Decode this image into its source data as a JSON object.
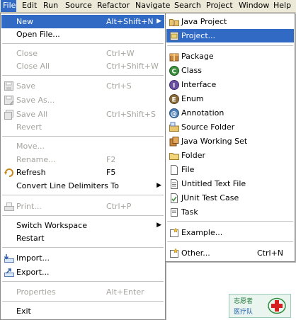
{
  "menubar": [
    {
      "id": "file",
      "label": "File"
    },
    {
      "id": "edit",
      "label": "Edit"
    },
    {
      "id": "run",
      "label": "Run"
    },
    {
      "id": "source",
      "label": "Source"
    },
    {
      "id": "refactor",
      "label": "Refactor"
    },
    {
      "id": "navigate",
      "label": "Navigate"
    },
    {
      "id": "search",
      "label": "Search"
    },
    {
      "id": "project",
      "label": "Project"
    },
    {
      "id": "window",
      "label": "Window"
    },
    {
      "id": "help",
      "label": "Help"
    }
  ],
  "file_menu": {
    "new": {
      "label": "New",
      "shortcut": "Alt+Shift+N"
    },
    "open_file": {
      "label": "Open File..."
    },
    "close": {
      "label": "Close",
      "shortcut": "Ctrl+W"
    },
    "close_all": {
      "label": "Close All",
      "shortcut": "Ctrl+Shift+W"
    },
    "save": {
      "label": "Save",
      "shortcut": "Ctrl+S"
    },
    "save_as": {
      "label": "Save As..."
    },
    "save_all": {
      "label": "Save All",
      "shortcut": "Ctrl+Shift+S"
    },
    "revert": {
      "label": "Revert"
    },
    "move": {
      "label": "Move..."
    },
    "rename": {
      "label": "Rename...",
      "shortcut": "F2"
    },
    "refresh": {
      "label": "Refresh",
      "shortcut": "F5"
    },
    "convert": {
      "label": "Convert Line Delimiters To"
    },
    "print": {
      "label": "Print...",
      "shortcut": "Ctrl+P"
    },
    "switch_workspace": {
      "label": "Switch Workspace"
    },
    "restart": {
      "label": "Restart"
    },
    "import": {
      "label": "Import..."
    },
    "export": {
      "label": "Export..."
    },
    "properties": {
      "label": "Properties",
      "shortcut": "Alt+Enter"
    },
    "exit": {
      "label": "Exit"
    }
  },
  "new_menu": {
    "java_project": {
      "label": "Java Project"
    },
    "project": {
      "label": "Project..."
    },
    "package": {
      "label": "Package"
    },
    "class": {
      "label": "Class"
    },
    "interface": {
      "label": "Interface"
    },
    "enum": {
      "label": "Enum"
    },
    "annotation": {
      "label": "Annotation"
    },
    "source_folder": {
      "label": "Source Folder"
    },
    "java_working_set": {
      "label": "Java Working Set"
    },
    "folder": {
      "label": "Folder"
    },
    "file": {
      "label": "File"
    },
    "untitled_text_file": {
      "label": "Untitled Text File"
    },
    "junit_test_case": {
      "label": "JUnit Test Case"
    },
    "task": {
      "label": "Task"
    },
    "example": {
      "label": "Example..."
    },
    "other": {
      "label": "Other...",
      "shortcut": "Ctrl+N"
    }
  },
  "colors": {
    "highlight": "#316ac5",
    "menubar_bg": "#ece9d8",
    "disabled_text": "#a6a59e"
  },
  "logo": {
    "line1": "志愿者",
    "line2": "医疗队"
  }
}
